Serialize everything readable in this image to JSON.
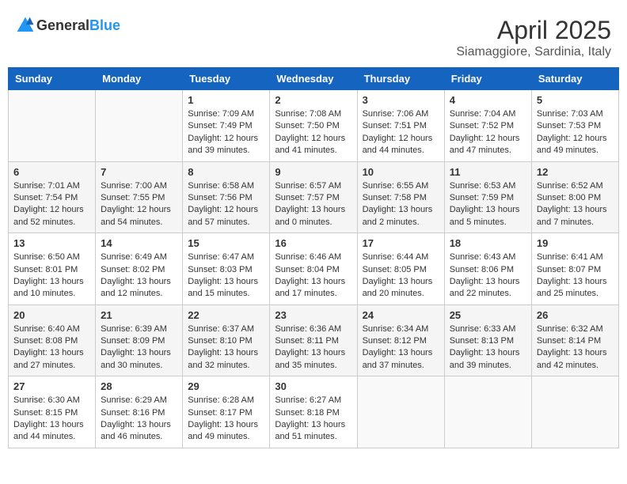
{
  "header": {
    "logo_general": "General",
    "logo_blue": "Blue",
    "title": "April 2025",
    "location": "Siamaggiore, Sardinia, Italy"
  },
  "weekdays": [
    "Sunday",
    "Monday",
    "Tuesday",
    "Wednesday",
    "Thursday",
    "Friday",
    "Saturday"
  ],
  "weeks": [
    [
      {
        "day": "",
        "content": ""
      },
      {
        "day": "",
        "content": ""
      },
      {
        "day": "1",
        "content": "Sunrise: 7:09 AM\nSunset: 7:49 PM\nDaylight: 12 hours and 39 minutes."
      },
      {
        "day": "2",
        "content": "Sunrise: 7:08 AM\nSunset: 7:50 PM\nDaylight: 12 hours and 41 minutes."
      },
      {
        "day": "3",
        "content": "Sunrise: 7:06 AM\nSunset: 7:51 PM\nDaylight: 12 hours and 44 minutes."
      },
      {
        "day": "4",
        "content": "Sunrise: 7:04 AM\nSunset: 7:52 PM\nDaylight: 12 hours and 47 minutes."
      },
      {
        "day": "5",
        "content": "Sunrise: 7:03 AM\nSunset: 7:53 PM\nDaylight: 12 hours and 49 minutes."
      }
    ],
    [
      {
        "day": "6",
        "content": "Sunrise: 7:01 AM\nSunset: 7:54 PM\nDaylight: 12 hours and 52 minutes."
      },
      {
        "day": "7",
        "content": "Sunrise: 7:00 AM\nSunset: 7:55 PM\nDaylight: 12 hours and 54 minutes."
      },
      {
        "day": "8",
        "content": "Sunrise: 6:58 AM\nSunset: 7:56 PM\nDaylight: 12 hours and 57 minutes."
      },
      {
        "day": "9",
        "content": "Sunrise: 6:57 AM\nSunset: 7:57 PM\nDaylight: 13 hours and 0 minutes."
      },
      {
        "day": "10",
        "content": "Sunrise: 6:55 AM\nSunset: 7:58 PM\nDaylight: 13 hours and 2 minutes."
      },
      {
        "day": "11",
        "content": "Sunrise: 6:53 AM\nSunset: 7:59 PM\nDaylight: 13 hours and 5 minutes."
      },
      {
        "day": "12",
        "content": "Sunrise: 6:52 AM\nSunset: 8:00 PM\nDaylight: 13 hours and 7 minutes."
      }
    ],
    [
      {
        "day": "13",
        "content": "Sunrise: 6:50 AM\nSunset: 8:01 PM\nDaylight: 13 hours and 10 minutes."
      },
      {
        "day": "14",
        "content": "Sunrise: 6:49 AM\nSunset: 8:02 PM\nDaylight: 13 hours and 12 minutes."
      },
      {
        "day": "15",
        "content": "Sunrise: 6:47 AM\nSunset: 8:03 PM\nDaylight: 13 hours and 15 minutes."
      },
      {
        "day": "16",
        "content": "Sunrise: 6:46 AM\nSunset: 8:04 PM\nDaylight: 13 hours and 17 minutes."
      },
      {
        "day": "17",
        "content": "Sunrise: 6:44 AM\nSunset: 8:05 PM\nDaylight: 13 hours and 20 minutes."
      },
      {
        "day": "18",
        "content": "Sunrise: 6:43 AM\nSunset: 8:06 PM\nDaylight: 13 hours and 22 minutes."
      },
      {
        "day": "19",
        "content": "Sunrise: 6:41 AM\nSunset: 8:07 PM\nDaylight: 13 hours and 25 minutes."
      }
    ],
    [
      {
        "day": "20",
        "content": "Sunrise: 6:40 AM\nSunset: 8:08 PM\nDaylight: 13 hours and 27 minutes."
      },
      {
        "day": "21",
        "content": "Sunrise: 6:39 AM\nSunset: 8:09 PM\nDaylight: 13 hours and 30 minutes."
      },
      {
        "day": "22",
        "content": "Sunrise: 6:37 AM\nSunset: 8:10 PM\nDaylight: 13 hours and 32 minutes."
      },
      {
        "day": "23",
        "content": "Sunrise: 6:36 AM\nSunset: 8:11 PM\nDaylight: 13 hours and 35 minutes."
      },
      {
        "day": "24",
        "content": "Sunrise: 6:34 AM\nSunset: 8:12 PM\nDaylight: 13 hours and 37 minutes."
      },
      {
        "day": "25",
        "content": "Sunrise: 6:33 AM\nSunset: 8:13 PM\nDaylight: 13 hours and 39 minutes."
      },
      {
        "day": "26",
        "content": "Sunrise: 6:32 AM\nSunset: 8:14 PM\nDaylight: 13 hours and 42 minutes."
      }
    ],
    [
      {
        "day": "27",
        "content": "Sunrise: 6:30 AM\nSunset: 8:15 PM\nDaylight: 13 hours and 44 minutes."
      },
      {
        "day": "28",
        "content": "Sunrise: 6:29 AM\nSunset: 8:16 PM\nDaylight: 13 hours and 46 minutes."
      },
      {
        "day": "29",
        "content": "Sunrise: 6:28 AM\nSunset: 8:17 PM\nDaylight: 13 hours and 49 minutes."
      },
      {
        "day": "30",
        "content": "Sunrise: 6:27 AM\nSunset: 8:18 PM\nDaylight: 13 hours and 51 minutes."
      },
      {
        "day": "",
        "content": ""
      },
      {
        "day": "",
        "content": ""
      },
      {
        "day": "",
        "content": ""
      }
    ]
  ]
}
